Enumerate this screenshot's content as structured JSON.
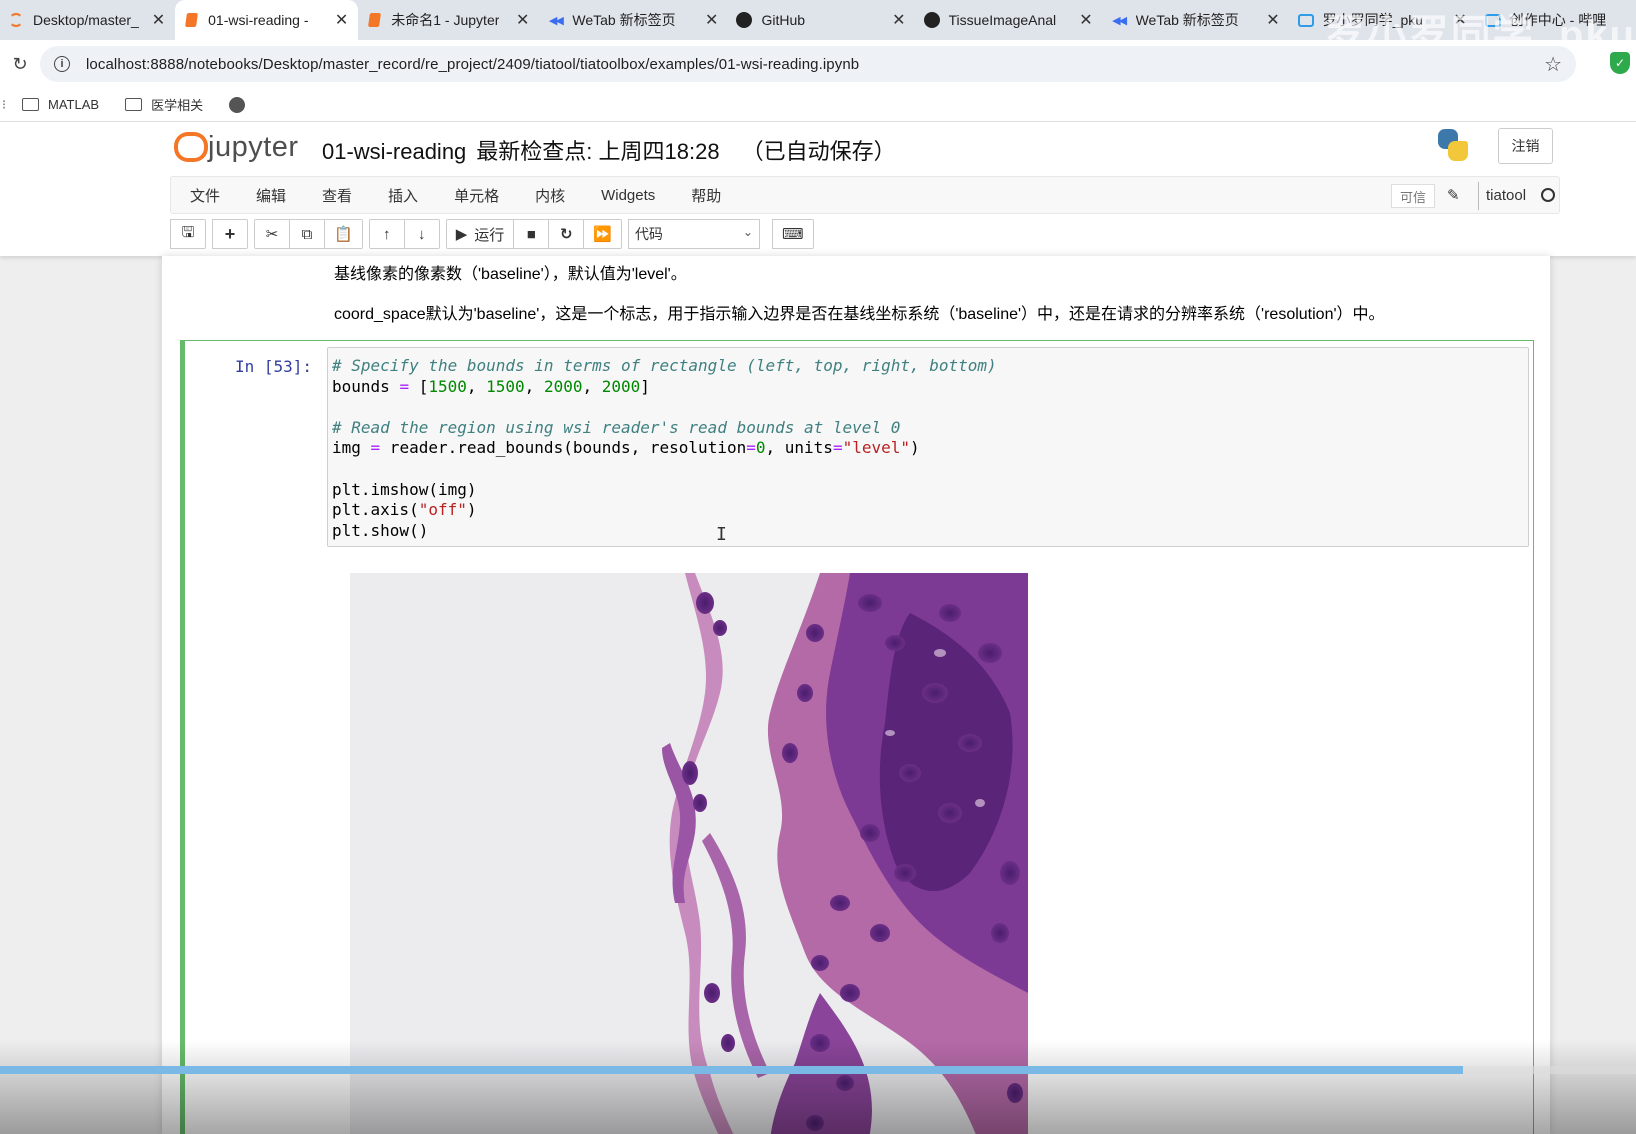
{
  "browser": {
    "tabs": [
      {
        "title": "Desktop/master_",
        "icon": "jupyter-ring-icon",
        "active": false
      },
      {
        "title": "01-wsi-reading -",
        "icon": "notebook-icon",
        "active": true
      },
      {
        "title": "未命名1 - Jupyter",
        "icon": "notebook-icon",
        "active": false
      },
      {
        "title": "WeTab 新标签页",
        "icon": "wetab-icon",
        "active": false
      },
      {
        "title": "GitHub",
        "icon": "github-icon",
        "active": false
      },
      {
        "title": "TissueImageAnal",
        "icon": "github-icon",
        "active": false
      },
      {
        "title": "WeTab 新标签页",
        "icon": "wetab-icon",
        "active": false
      },
      {
        "title": "罗小罗同学_pku",
        "icon": "bilibili-icon",
        "active": false
      },
      {
        "title": "创作中心 - 哔哩",
        "icon": "bilibili-icon",
        "active": false
      }
    ],
    "watermark": "罗小罗同学_pku",
    "url": "localhost:8888/notebooks/Desktop/master_record/re_project/2409/tiatool/tiatoolbox/examples/01-wsi-reading.ipynb",
    "bookmarks": [
      {
        "label": "MATLAB",
        "icon": "folder-icon"
      },
      {
        "label": "医学相关",
        "icon": "folder-icon"
      },
      {
        "label": "",
        "icon": "globe-icon"
      }
    ]
  },
  "jupyter": {
    "logo_text": "jupyter",
    "notebook_name": "01-wsi-reading",
    "checkpoint": "最新检查点: 上周四18:28",
    "autosave": "（已自动保存）",
    "logout_label": "注销",
    "menu": [
      "文件",
      "编辑",
      "查看",
      "插入",
      "单元格",
      "内核",
      "Widgets",
      "帮助"
    ],
    "trusted_label": "可信",
    "kernel_name": "tiatool",
    "toolbar": {
      "run_label": "运行",
      "cell_type": "代码"
    }
  },
  "notebook": {
    "markdown": [
      "基线像素的像素数（'baseline'），默认值为'level'。",
      "coord_space默认为'baseline'，这是一个标志，用于指示输入边界是否在基线坐标系统（'baseline'）中，还是在请求的分辨率系统（'resolution'）中。"
    ],
    "cell": {
      "prompt": "In [53]:",
      "code": {
        "l1": "# Specify the bounds in terms of rectangle (left, top, right, bottom)",
        "l2a": "bounds ",
        "l2b": "=",
        "l2c": " [",
        "l2d": "1500",
        "l2e": ", ",
        "l2f": "1500",
        "l2g": ", ",
        "l2h": "2000",
        "l2i": ", ",
        "l2j": "2000",
        "l2k": "]",
        "l4": "# Read the region using wsi reader's read bounds at level 0",
        "l5a": "img ",
        "l5b": "=",
        "l5c": " reader.read_bounds(bounds, resolution",
        "l5d": "=",
        "l5e": "0",
        "l5f": ", units",
        "l5g": "=",
        "l5h": "\"level\"",
        "l5i": ")",
        "l7": "plt.imshow(img)",
        "l8a": "plt.axis(",
        "l8b": "\"off\"",
        "l8c": ")",
        "l9": "plt.show()"
      }
    }
  },
  "video": {
    "progress_fraction": 0.894
  },
  "colors": {
    "accent_orange": "#f37726",
    "cell_selected": "#66bb6a",
    "prompt_blue": "#303f9f",
    "progress_blue": "#7ab8e6",
    "tissue_purple": "#6b2f86",
    "tissue_pink": "#b56aa8"
  }
}
